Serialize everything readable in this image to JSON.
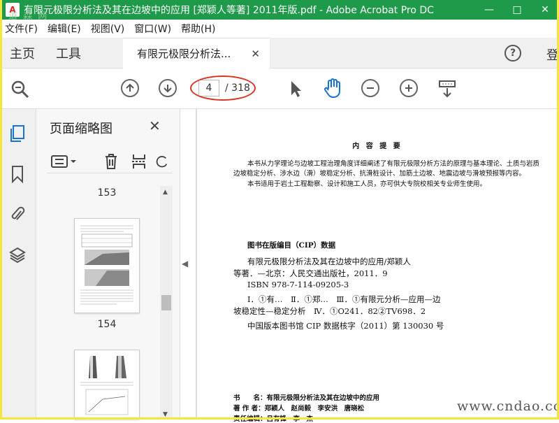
{
  "window": {
    "title": "有限元极限分析法及其在边坡中的应用 [郑颖人等著] 2011年版.pdf - Adobe Acrobat Pro DC",
    "watermark": "道 森 网",
    "controls": {
      "minimize": "—",
      "restore": "□",
      "close": "✕"
    }
  },
  "menu": [
    "文件(F)",
    "编辑(E)",
    "视图(V)",
    "窗口(W)",
    "帮助(H)"
  ],
  "tabs": {
    "home": "主页",
    "tools": "工具",
    "document": "有限元极限分析法...",
    "close": "✕",
    "signin": "登"
  },
  "toolbar": {
    "current_page": "4",
    "total_pages": "/ 318"
  },
  "panel": {
    "title": "页面缩略图",
    "close": "✕",
    "thumbnails": [
      {
        "label": "153"
      },
      {
        "label": "154"
      }
    ]
  },
  "document": {
    "summary_title": "内 容 提 要",
    "summary_lines": [
      "本书从力学理论与边坡工程治理角度详细阐述了有限元极限分析方法的原理与基本理论、土质与岩质",
      "边坡稳定分析、涉水边（滑）坡稳定分析、抗滑桩设计、加筋土边坡、地震边坡与滑坡预报等内容。",
      "本书适用于岩土工程勘察、设计和施工人员，亦可供大专院校相关专业师生使用。"
    ],
    "cip_heading": "图书在版编目（CIP）数据",
    "cip_lines": [
      "有限元极限分析法及其在边坡中的应用/郑颖人",
      "等著．—北京：人民交通出版社，2011．9",
      "ISBN  978-7-114-09205-3",
      "Ⅰ．①有…　Ⅱ．①郑…　Ⅲ．①有限元分析—应用—边",
      "坡稳定性—稳定分析　Ⅳ．①O241．82②TV698．2",
      "中国版本图书馆 CIP 数据核字（2011）第 130030 号"
    ],
    "book_lines": [
      "书　　名：有限元极限分析法及其在边坡中的应用",
      "著 作 者：郑颖人　赵尚毅　李安洪　唐晓松",
      "责任编辑：吕有锋　李　杰"
    ]
  },
  "bottom_watermark": "www.cndao.com"
}
